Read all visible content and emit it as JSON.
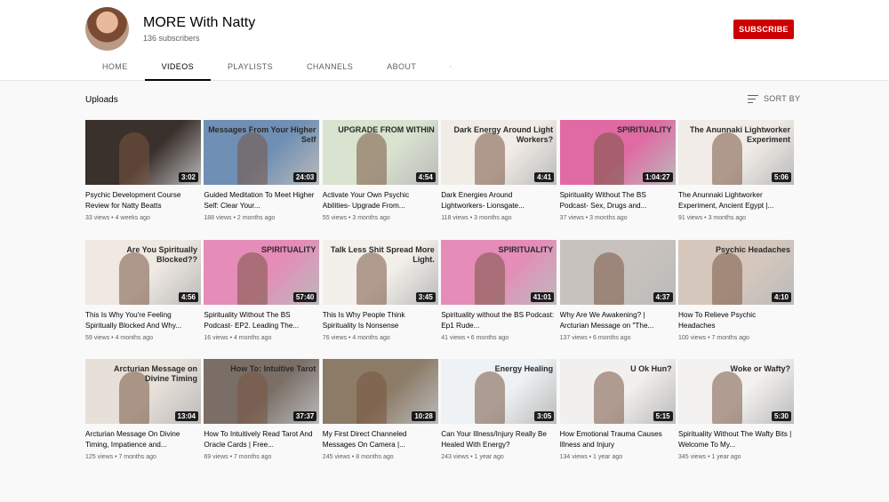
{
  "channel": {
    "name": "MORE With Natty",
    "subscribers": "136 subscribers",
    "subscribe_label": "SUBSCRIBE"
  },
  "tabs": [
    "HOME",
    "VIDEOS",
    "PLAYLISTS",
    "CHANNELS",
    "ABOUT"
  ],
  "active_tab": "VIDEOS",
  "section": {
    "title": "Uploads",
    "sort_label": "SORT BY"
  },
  "videos": [
    {
      "title": "Psychic Development Course Review for Natty Beatts",
      "meta": "33 views • 4 weeks ago",
      "duration": "3:02",
      "thumb_caption": "",
      "bg": "#3a302c"
    },
    {
      "title": "Guided Meditation To Meet Higher Self: Clear Your...",
      "meta": "188 views • 2 months ago",
      "duration": "24:03",
      "thumb_caption": "Messages From Your Higher Self",
      "bg": "#6f8fb4"
    },
    {
      "title": "Activate Your Own Psychic Abilities- Upgrade From...",
      "meta": "55 views • 3 months ago",
      "duration": "4:54",
      "thumb_caption": "UPGRADE FROM WITHIN",
      "bg": "#d9e3cf"
    },
    {
      "title": "Dark Energies Around Lightworkers- Lionsgate...",
      "meta": "118 views • 3 months ago",
      "duration": "4:41",
      "thumb_caption": "Dark Energy Around Light Workers?",
      "bg": "#f2ece6"
    },
    {
      "title": "Spirituality Without The BS Podcast- Sex, Drugs and...",
      "meta": "37 views • 3 months ago",
      "duration": "1:04:27",
      "thumb_caption": "SPIRITUALITY",
      "bg": "#e06aa3"
    },
    {
      "title": "The Anunnaki Lightworker Experiment, Ancient Egypt |...",
      "meta": "91 views • 3 months ago",
      "duration": "5:06",
      "thumb_caption": "The Anunnaki Lightworker Experiment",
      "bg": "#f1ece7"
    },
    {
      "title": "This Is Why You're Feeling Spiritually Blocked And Why...",
      "meta": "59 views • 4 months ago",
      "duration": "4:56",
      "thumb_caption": "Are You Spiritually Blocked??",
      "bg": "#efe9e2"
    },
    {
      "title": "Spirituality Without The BS Podcast- EP2. Leading The...",
      "meta": "16 views • 4 months ago",
      "duration": "57:40",
      "thumb_caption": "SPIRITUALITY",
      "bg": "#e58cb8"
    },
    {
      "title": "This Is Why People Think Spirituality Is Nonsense",
      "meta": "76 views • 4 months ago",
      "duration": "3:45",
      "thumb_caption": "Talk Less Shit Spread More Light.",
      "bg": "#f3efea"
    },
    {
      "title": "Spirituality without the BS Podcast: Ep1 Rude...",
      "meta": "41 views • 6 months ago",
      "duration": "41:01",
      "thumb_caption": "SPIRITUALITY",
      "bg": "#e58cb8"
    },
    {
      "title": "Why Are We Awakening? | Arcturian Message on \"The...",
      "meta": "137 views • 6 months ago",
      "duration": "4:37",
      "thumb_caption": "",
      "bg": "#c7c2bd"
    },
    {
      "title": "How To Relieve Psychic Headaches",
      "meta": "100 views • 7 months ago",
      "duration": "4:10",
      "thumb_caption": "Psychic Headaches",
      "bg": "#d6c7bc"
    },
    {
      "title": "Arcturian Message On Divine Timing, Impatience and...",
      "meta": "125 views • 7 months ago",
      "duration": "13:04",
      "thumb_caption": "Arcturian Message on Divine Timing",
      "bg": "#e7e0d8"
    },
    {
      "title": "How To Intuitively Read Tarot And Oracle Cards | Free...",
      "meta": "69 views • 7 months ago",
      "duration": "37:37",
      "thumb_caption": "How To: Intuitive Tarot",
      "bg": "#7a6e66"
    },
    {
      "title": "My First Direct Channeled Messages On Camera |...",
      "meta": "245 views • 8 months ago",
      "duration": "10:28",
      "thumb_caption": "",
      "bg": "#8c7b66"
    },
    {
      "title": "Can Your Illness/Injury Really Be Healed With Energy?",
      "meta": "243 views • 1 year ago",
      "duration": "3:05",
      "thumb_caption": "Energy Healing",
      "bg": "#eef2f4"
    },
    {
      "title": "How Emotional Trauma Causes Illness and Injury",
      "meta": "134 views • 1 year ago",
      "duration": "5:15",
      "thumb_caption": "U Ok Hun?",
      "bg": "#f2f0ee"
    },
    {
      "title": "Spirituality Without The Wafty Bits | Welcome To My...",
      "meta": "345 views • 1 year ago",
      "duration": "5:30",
      "thumb_caption": "Woke or Wafty?",
      "bg": "#f3f1ef"
    }
  ]
}
